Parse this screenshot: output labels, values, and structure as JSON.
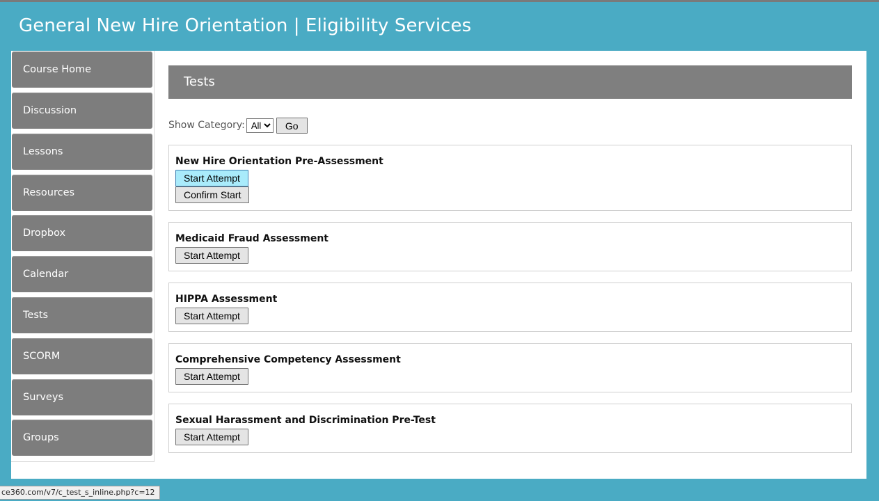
{
  "header": {
    "title": "General New Hire Orientation | Eligibility Services"
  },
  "sidebar": {
    "items": [
      {
        "label": "Course Home"
      },
      {
        "label": "Discussion"
      },
      {
        "label": "Lessons"
      },
      {
        "label": "Resources"
      },
      {
        "label": "Dropbox"
      },
      {
        "label": "Calendar"
      },
      {
        "label": "Tests"
      },
      {
        "label": "SCORM"
      },
      {
        "label": "Surveys"
      },
      {
        "label": "Groups"
      }
    ]
  },
  "main": {
    "heading": "Tests",
    "filter": {
      "label": "Show Category:",
      "selected": "All",
      "go_label": "Go"
    },
    "tests": [
      {
        "title": "New Hire Orientation Pre-Assessment",
        "start_label": "Start Attempt",
        "confirm_label": "Confirm Start"
      },
      {
        "title": "Medicaid Fraud Assessment",
        "start_label": "Start Attempt"
      },
      {
        "title": "HIPPA Assessment",
        "start_label": "Start Attempt"
      },
      {
        "title": "Comprehensive Competency Assessment",
        "start_label": "Start Attempt"
      },
      {
        "title": "Sexual Harassment and Discrimination Pre-Test",
        "start_label": "Start Attempt"
      }
    ]
  },
  "status_bar": {
    "url": "ce360.com/v7/c_test_s_inline.php?c=12"
  },
  "colors": {
    "background": "#4aabc4",
    "nav": "#7d7d7d",
    "heading_bar": "#7f7f7f",
    "button_hover": "#a9ebfb"
  }
}
